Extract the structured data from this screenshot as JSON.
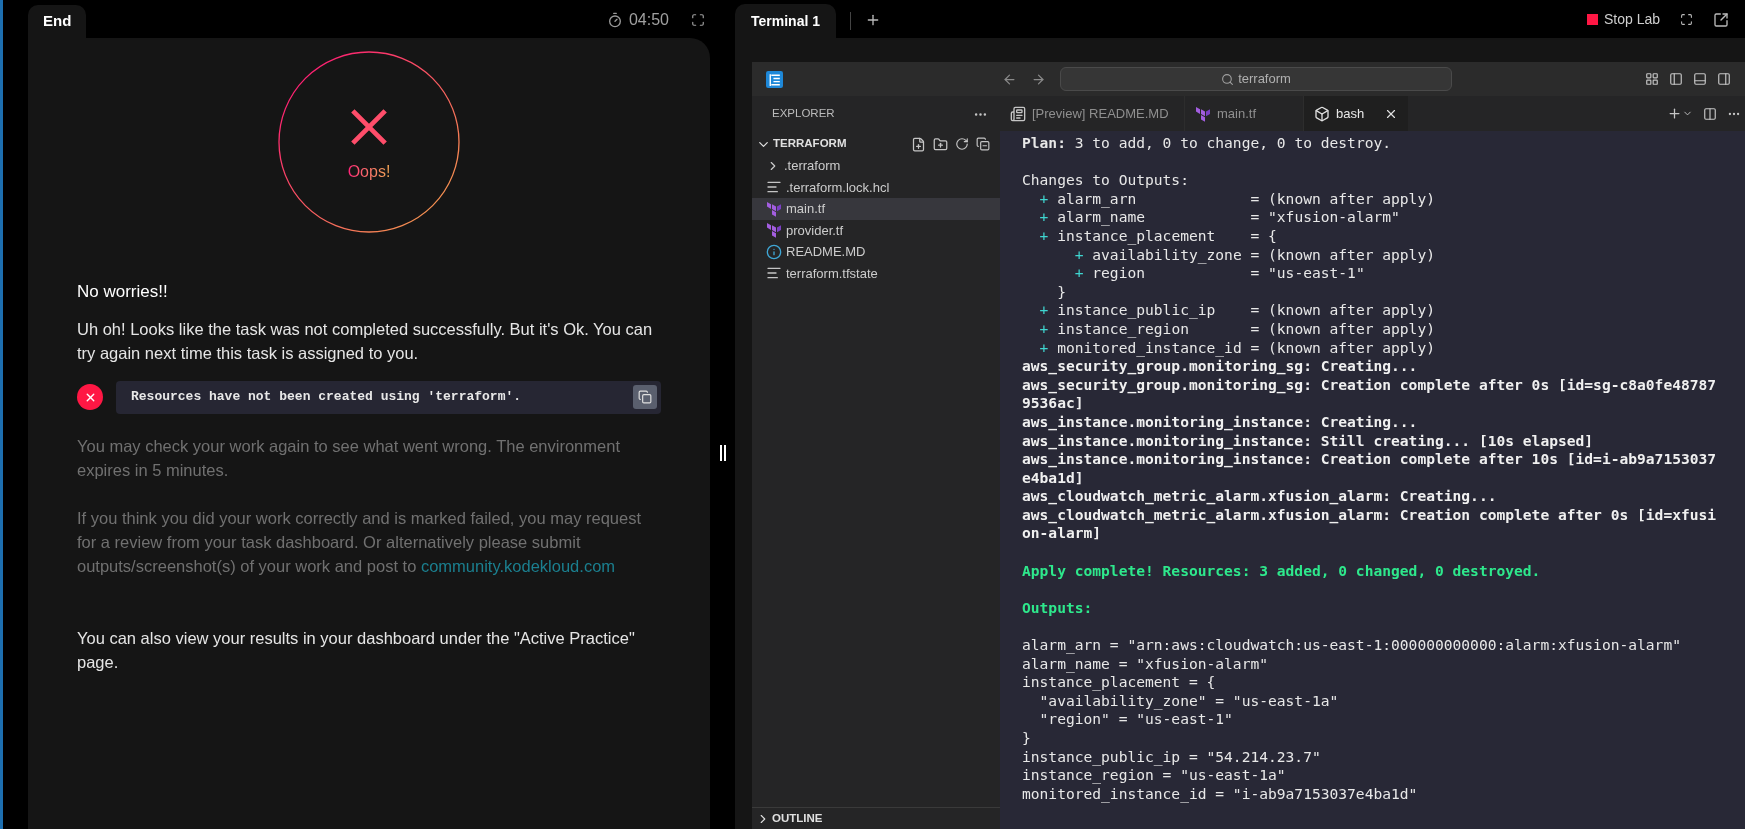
{
  "left_panel": {
    "tab": "End",
    "timer": "04:50",
    "result": {
      "failed": true,
      "label": "Oops!"
    },
    "heading": "No worries!!",
    "intro": "Uh oh! Looks like the task was not completed successfully. But it's Ok. You can try again next time this task is assigned to you.",
    "checks": [
      {
        "failed": true,
        "message": "Resources have not been created using 'terraform'."
      }
    ],
    "note": "You may check your work again to see what went wrong. The environment expires in 5 minutes.",
    "review_note": {
      "text": "If you think you did your work correctly and is marked failed, you may request for a review from your task dashboard. Or alternatively please submit outputs/screenshot(s) of your work and post to",
      "link": "community.kodekloud.com"
    },
    "footer": "You can also view your results in your dashboard under the \"Active Practice\" page."
  },
  "right_panel": {
    "tabs": [
      {
        "label": "Terminal 1",
        "selected": true
      }
    ],
    "stop_button": "Stop Lab",
    "editor": {
      "search": "terraform",
      "explorer": {
        "title": "EXPLORER",
        "folder": {
          "name": "TERRAFORM",
          "expanded": true,
          "items": [
            {
              "name": ".terraform",
              "kind": "folder",
              "expanded": false,
              "selected": false
            },
            {
              "name": ".terraform.lock.hcl",
              "kind": "text",
              "selected": false
            },
            {
              "name": "main.tf",
              "kind": "terraform",
              "selected": true
            },
            {
              "name": "provider.tf",
              "kind": "terraform",
              "selected": false
            },
            {
              "name": "README.MD",
              "kind": "info",
              "selected": false
            },
            {
              "name": "terraform.tfstate",
              "kind": "text",
              "selected": false
            }
          ]
        },
        "outline": {
          "name": "OUTLINE",
          "expanded": false
        }
      },
      "tabs": [
        {
          "label": "[Preview] README.MD",
          "kind": "preview",
          "selected": false
        },
        {
          "label": "main.tf",
          "kind": "terraform",
          "selected": false
        },
        {
          "label": "bash",
          "kind": "terminal",
          "selected": true
        }
      ],
      "terminal": [
        {
          "kind": "plain",
          "text": "**Plan:** 3 to add, 0 to change, 0 to destroy."
        },
        {
          "kind": "blank"
        },
        {
          "kind": "plain",
          "text": "Changes to Outputs:"
        },
        {
          "kind": "change",
          "sign": "+",
          "text": "alarm_arn             = (known after apply)"
        },
        {
          "kind": "change",
          "sign": "+",
          "text": "alarm_name            = \"xfusion-alarm\""
        },
        {
          "kind": "change",
          "sign": "+",
          "text": "instance_placement    = {",
          "children": [
            {
              "sign": "+",
              "text": "availability_zone = (known after apply)"
            },
            {
              "sign": "+",
              "text": "region            = \"us-east-1\""
            }
          ],
          "close": "}"
        },
        {
          "kind": "change",
          "sign": "+",
          "text": "instance_public_ip    = (known after apply)"
        },
        {
          "kind": "change",
          "sign": "+",
          "text": "instance_region       = (known after apply)"
        },
        {
          "kind": "change",
          "sign": "+",
          "text": "monitored_instance_id = (known after apply)"
        },
        {
          "kind": "bold",
          "text": "aws_security_group.monitoring_sg: Creating..."
        },
        {
          "kind": "bold",
          "text": "aws_security_group.monitoring_sg: Creation complete after 0s [id=sg-c8a0fe48787"
        },
        {
          "kind": "bold",
          "text": "9536ac]"
        },
        {
          "kind": "bold",
          "text": "aws_instance.monitoring_instance: Creating..."
        },
        {
          "kind": "bold",
          "text": "aws_instance.monitoring_instance: Still creating... [10s elapsed]"
        },
        {
          "kind": "bold",
          "text": "aws_instance.monitoring_instance: Creation complete after 10s [id=i-ab9a7153037"
        },
        {
          "kind": "bold",
          "text": "e4ba1d]"
        },
        {
          "kind": "bold",
          "text": "aws_cloudwatch_metric_alarm.xfusion_alarm: Creating..."
        },
        {
          "kind": "bold",
          "text": "aws_cloudwatch_metric_alarm.xfusion_alarm: Creation complete after 0s [id=xfusi"
        },
        {
          "kind": "bold",
          "text": "on-alarm]"
        },
        {
          "kind": "blank"
        },
        {
          "kind": "success",
          "text": "Apply complete! Resources: 3 added, 0 changed, 0 destroyed."
        },
        {
          "kind": "blank"
        },
        {
          "kind": "success",
          "text": "Outputs:"
        },
        {
          "kind": "blank"
        },
        {
          "kind": "plain",
          "text": "alarm_arn = \"arn:aws:cloudwatch:us-east-1:000000000000:alarm:xfusion-alarm\""
        },
        {
          "kind": "plain",
          "text": "alarm_name = \"xfusion-alarm\""
        },
        {
          "kind": "plain",
          "text": "instance_placement = {"
        },
        {
          "kind": "plain",
          "text": "  \"availability_zone\" = \"us-east-1a\""
        },
        {
          "kind": "plain",
          "text": "  \"region\" = \"us-east-1\""
        },
        {
          "kind": "plain",
          "text": "}"
        },
        {
          "kind": "plain",
          "text": "instance_public_ip = \"54.214.23.7\""
        },
        {
          "kind": "plain",
          "text": "instance_region = \"us-east-1a\""
        },
        {
          "kind": "plain",
          "text": "monitored_instance_id = \"i-ab9a7153037e4ba1d\""
        }
      ]
    }
  }
}
